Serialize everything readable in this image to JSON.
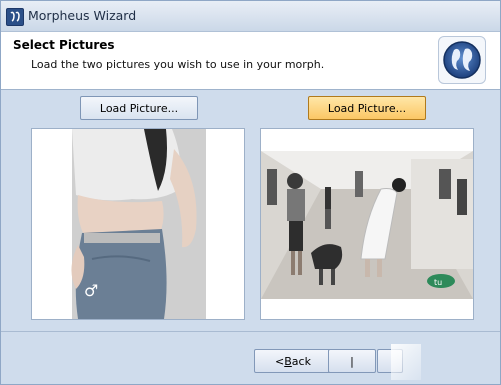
{
  "window": {
    "title": "Morpheus Wizard",
    "accent": "#cfdcec"
  },
  "header": {
    "title": "Select Pictures",
    "description": "Load the two pictures you wish to use in your morph."
  },
  "buttons": {
    "load_left": "Load Picture...",
    "load_right": "Load Picture...",
    "back_prefix": "< ",
    "back_mnemonic": "B",
    "back_rest": "ack",
    "next_glyph": "|"
  },
  "icons": {
    "app": "morpheus-app-icon",
    "logo": "morpheus-logo",
    "gender": "male-symbol-icon",
    "watermark": "image-watermark-logo"
  },
  "pictures": {
    "left_watermark": "♂",
    "right_watermark": "tu"
  }
}
